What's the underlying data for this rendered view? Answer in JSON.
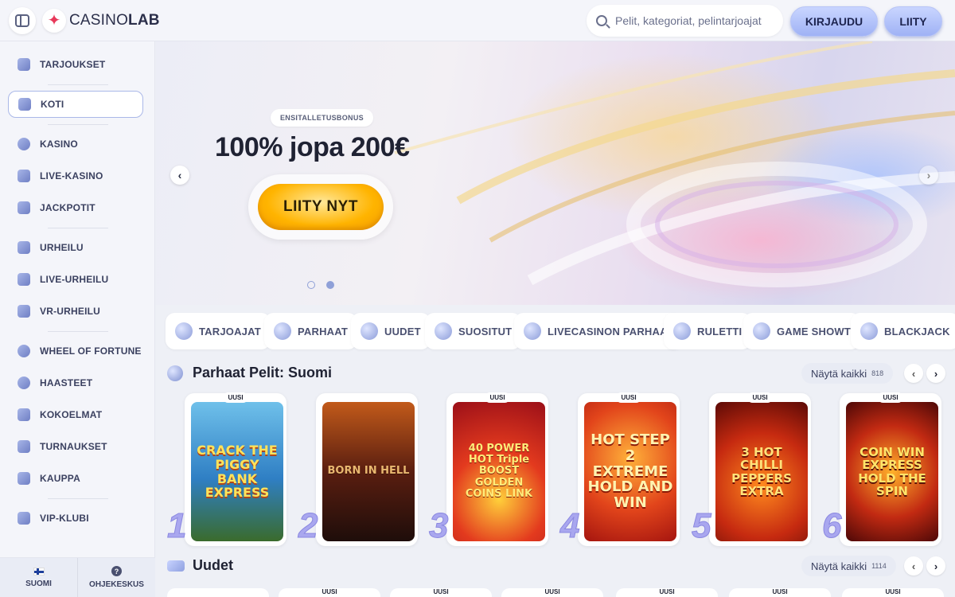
{
  "header": {
    "logo_text_a": "CASINO",
    "logo_text_b": "LAB",
    "search_placeholder": "Pelit, kategoriat, pelintarjoajat",
    "login_label": "KIRJAUDU",
    "join_label": "LIITY"
  },
  "sidebar": {
    "items": [
      {
        "label": "TARJOUKSET"
      },
      {
        "label": "KOTI"
      },
      {
        "label": "KASINO"
      },
      {
        "label": "LIVE-KASINO"
      },
      {
        "label": "JACKPOTIT"
      },
      {
        "label": "URHEILU"
      },
      {
        "label": "LIVE-URHEILU"
      },
      {
        "label": "VR-URHEILU"
      },
      {
        "label": "WHEEL OF FORTUNE"
      },
      {
        "label": "HAASTEET"
      },
      {
        "label": "KOKOELMAT"
      },
      {
        "label": "TURNAUKSET"
      },
      {
        "label": "KAUPPA"
      },
      {
        "label": "VIP-KLUBI"
      }
    ],
    "language_label": "SUOMI",
    "help_label": "OHJEKESKUS",
    "help_glyph": "?"
  },
  "banner": {
    "tag": "ENSITALLETUSBONUS",
    "title": "100% jopa 200€",
    "cta_label": "LIITY NYT",
    "prev_glyph": "‹",
    "next_glyph": "›"
  },
  "categories": [
    {
      "label": "TARJOAJAT"
    },
    {
      "label": "PARHAAT"
    },
    {
      "label": "UUDET"
    },
    {
      "label": "SUOSITUT"
    },
    {
      "label": "LIVECASINON PARHAAT"
    },
    {
      "label": "RULETTI"
    },
    {
      "label": "GAME SHOWT"
    },
    {
      "label": "BLACKJACK"
    }
  ],
  "best_section": {
    "title": "Parhaat Pelit: Suomi",
    "show_all_label": "Näytä kaikki",
    "count": "818",
    "prev_glyph": "‹",
    "next_glyph": "›"
  },
  "games": [
    {
      "badge": "UUSI",
      "rank": "1",
      "title": "CRACK THE PIGGY BANK EXPRESS"
    },
    {
      "badge": "",
      "rank": "2",
      "title": "BORN IN HELL"
    },
    {
      "badge": "UUSI",
      "rank": "3",
      "title": "40 POWER HOT Triple BOOST GOLDEN COINS LINK"
    },
    {
      "badge": "UUSI",
      "rank": "4",
      "title": "HOT STEP 2 EXTREME HOLD AND WIN"
    },
    {
      "badge": "UUSI",
      "rank": "5",
      "title": "3 HOT CHILLI PEPPERS EXTRA"
    },
    {
      "badge": "UUSI",
      "rank": "6",
      "title": "COIN WIN EXPRESS HOLD THE SPIN"
    }
  ],
  "new_section": {
    "title": "Uudet",
    "show_all_label": "Näytä kaikki",
    "count": "1114",
    "prev_glyph": "‹",
    "next_glyph": "›"
  },
  "new_games": [
    {
      "badge": ""
    },
    {
      "badge": "UUSI"
    },
    {
      "badge": "UUSI"
    },
    {
      "badge": "UUSI"
    },
    {
      "badge": "UUSI"
    },
    {
      "badge": "UUSI"
    },
    {
      "badge": "UUSI"
    }
  ]
}
